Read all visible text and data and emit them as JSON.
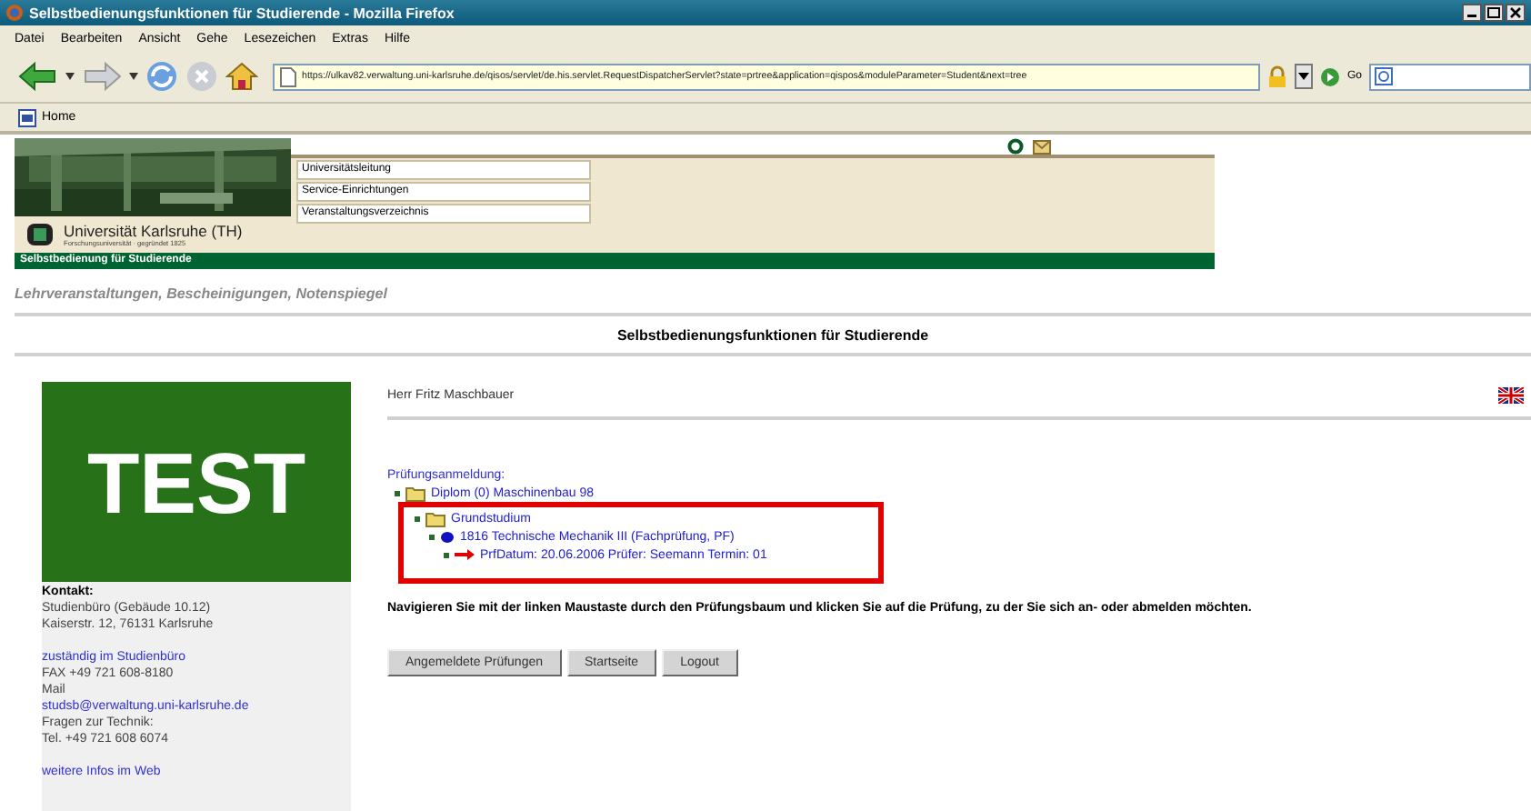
{
  "window": {
    "title": "Selbstbedienungsfunktionen für Studierende - Mozilla Firefox"
  },
  "menu": [
    "Datei",
    "Bearbeiten",
    "Ansicht",
    "Gehe",
    "Lesezeichen",
    "Extras",
    "Hilfe"
  ],
  "address": {
    "value": "https://ulkav82.verwaltung.uni-karlsruhe.de/qisos/servlet/de.his.servlet.RequestDispatcherServlet?state=prtree&application=qispos&moduleParameter=Student&next=tree"
  },
  "go_label": "Go",
  "bookmarks": [
    "Home"
  ],
  "header": {
    "links": [
      "Universitätsleitung",
      "Service-Einrichtungen",
      "Veranstaltungsverzeichnis"
    ],
    "university": "Universität Karlsruhe (TH)",
    "tagline": "Forschungsuniversität · gegründet 1825",
    "bar": "Selbstbedienung für Studierende"
  },
  "subtitle": "Lehrveranstaltungen, Bescheinigungen, Notenspiegel",
  "page_title": "Selbstbedienungsfunktionen für Studierende",
  "sidebar": {
    "badge": "TEST",
    "contact_heading": "Kontakt:",
    "contact_lines": [
      {
        "kind": "text",
        "text": "Studienbüro (Gebäude 10.12)"
      },
      {
        "kind": "text",
        "text": "Kaiserstr. 12, 76131 Karlsruhe"
      },
      {
        "kind": "gap"
      },
      {
        "kind": "link",
        "text": "zuständig im Studienbüro"
      },
      {
        "kind": "text",
        "text": "FAX +49 721 608-8180"
      },
      {
        "kind": "text",
        "text": "Mail"
      },
      {
        "kind": "link",
        "text": "studsb@verwaltung.uni-karlsruhe.de"
      },
      {
        "kind": "text",
        "text": "Fragen zur Technik:"
      },
      {
        "kind": "text",
        "text": "Tel. +49 721 608 6074"
      },
      {
        "kind": "gap"
      },
      {
        "kind": "link",
        "text": "weitere Infos im Web"
      }
    ]
  },
  "user": "Herr Fritz Maschbauer",
  "tree": {
    "heading": "Prüfungsanmeldung:",
    "items": [
      {
        "label": "Diplom (0) Maschinenbau 98",
        "kind": "folder",
        "highlighted": false,
        "children": [
          {
            "label": "Grundstudium",
            "kind": "folder",
            "highlighted": true,
            "children": [
              {
                "label": "1816 Technische Mechanik III (Fachprüfung, PF)",
                "kind": "ball",
                "highlighted": false,
                "children": [
                  {
                    "label": "PrfDatum: 20.06.2006 Prüfer: Seemann Termin: 01",
                    "kind": "arrow",
                    "highlighted": false
                  }
                ]
              }
            ]
          }
        ]
      }
    ]
  },
  "instruction": "Navigieren Sie mit der linken Maustaste durch den Prüfungsbaum und klicken Sie auf die Prüfung, zu der Sie sich an- oder abmelden möchten.",
  "buttons": [
    "Angemeldete Prüfungen",
    "Startseite",
    "Logout"
  ]
}
